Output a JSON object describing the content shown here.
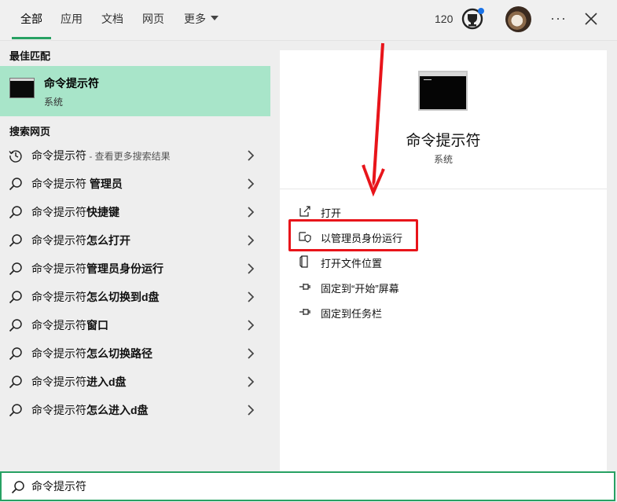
{
  "tabs": {
    "all": "全部",
    "apps": "应用",
    "docs": "文档",
    "web": "网页",
    "more": "更多"
  },
  "header": {
    "score": "120",
    "more_dots": "···"
  },
  "left": {
    "best_match_heading": "最佳匹配",
    "best_match": {
      "title": "命令提示符",
      "subtitle": "系统"
    },
    "web_heading": "搜索网页",
    "results": [
      {
        "prefix": "命令提示符",
        "suffix": " - 查看更多搜索结果",
        "icon": "history-icon"
      },
      {
        "prefix": "命令提示符 ",
        "bold": "管理员",
        "icon": "search-icon"
      },
      {
        "prefix": "命令提示符",
        "bold": "快捷键",
        "icon": "search-icon"
      },
      {
        "prefix": "命令提示符",
        "bold": "怎么打开",
        "icon": "search-icon"
      },
      {
        "prefix": "命令提示符",
        "bold": "管理员身份运行",
        "icon": "search-icon"
      },
      {
        "prefix": "命令提示符",
        "bold": "怎么切换到d盘",
        "icon": "search-icon"
      },
      {
        "prefix": "命令提示符",
        "bold": "窗口",
        "icon": "search-icon"
      },
      {
        "prefix": "命令提示符",
        "bold": "怎么切换路径",
        "icon": "search-icon"
      },
      {
        "prefix": "命令提示符",
        "bold": "进入d盘",
        "icon": "search-icon"
      },
      {
        "prefix": "命令提示符",
        "bold": "怎么进入d盘",
        "icon": "search-icon"
      }
    ]
  },
  "detail": {
    "title": "命令提示符",
    "subtitle": "系统",
    "actions": [
      {
        "label": "打开",
        "icon": "open-icon"
      },
      {
        "label": "以管理员身份运行",
        "icon": "admin-shield-icon"
      },
      {
        "label": "打开文件位置",
        "icon": "file-location-icon"
      },
      {
        "label": "固定到“开始”屏幕",
        "icon": "pin-icon"
      },
      {
        "label": "固定到任务栏",
        "icon": "pin-icon"
      }
    ]
  },
  "search": {
    "value": "命令提示符"
  },
  "colors": {
    "accent": "#27a163",
    "best_match_bg": "#a8e5c9",
    "annotation_red": "#e8141a"
  }
}
